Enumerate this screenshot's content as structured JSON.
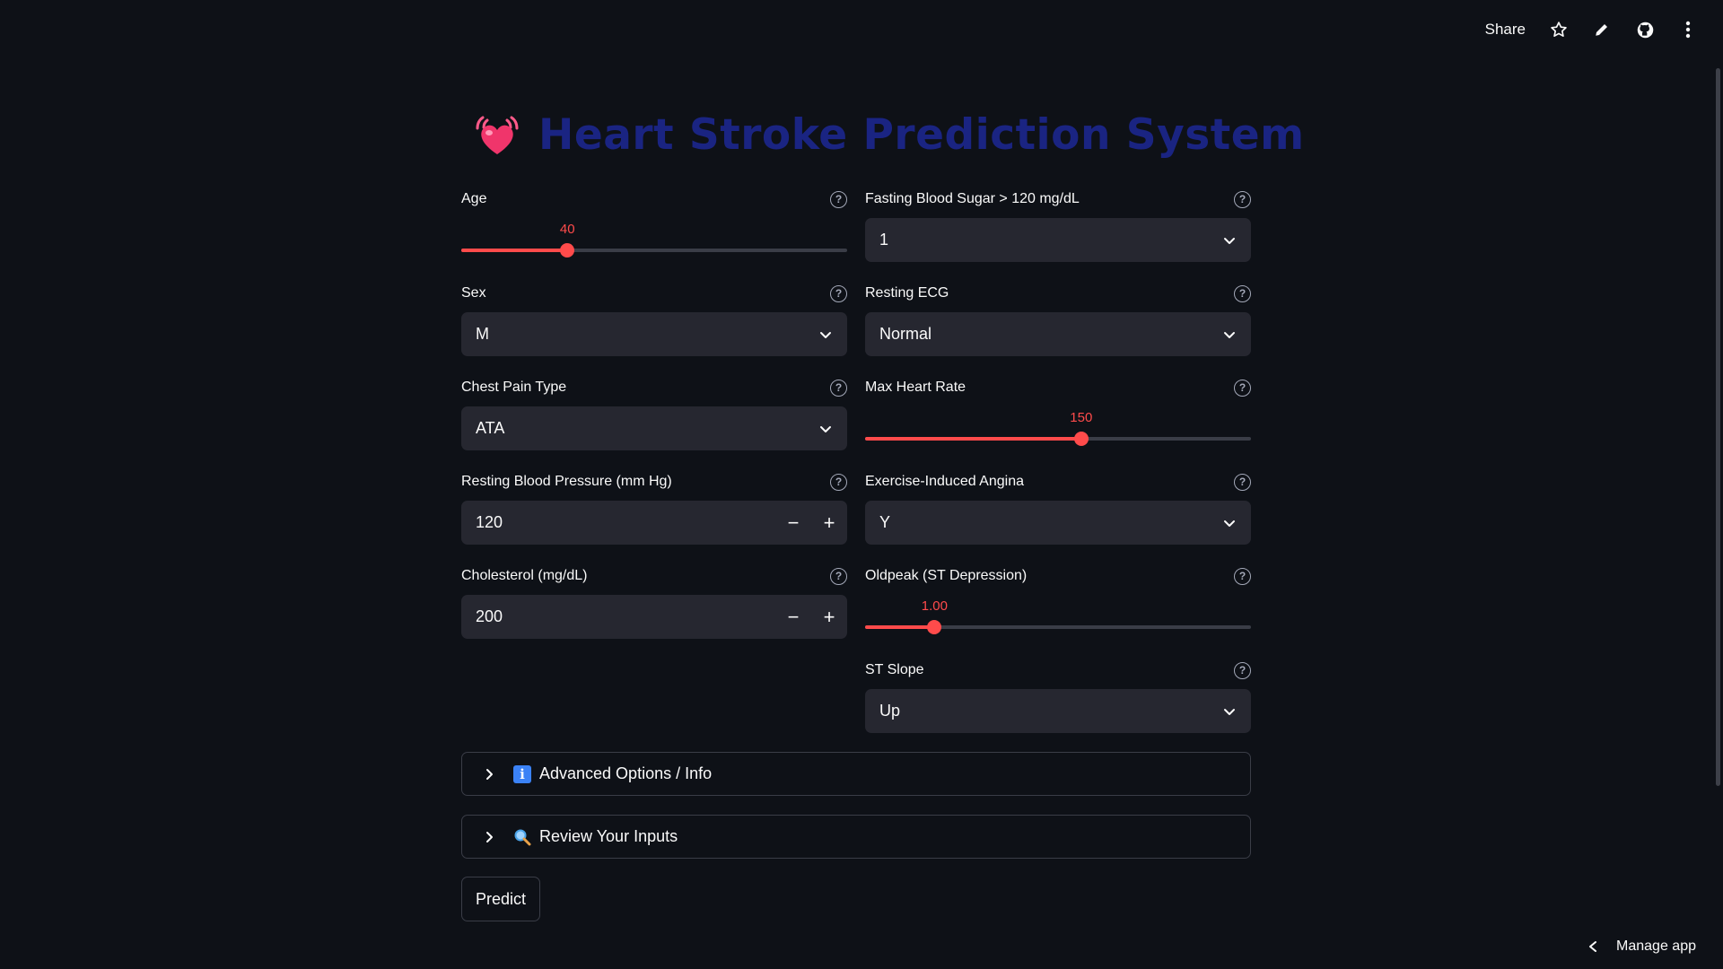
{
  "toolbar": {
    "share_label": "Share",
    "icons": [
      "star-icon",
      "pencil-icon",
      "github-icon",
      "more-vertical-icon"
    ]
  },
  "title": {
    "text": "Heart Stroke Prediction System",
    "icon": "heart-icon",
    "color": "#1a2482"
  },
  "fields": {
    "age": {
      "label": "Age",
      "value": "40",
      "min": 0,
      "max": 110,
      "fill_fraction": 0.275
    },
    "sex": {
      "label": "Sex",
      "value": "M"
    },
    "chest_pain": {
      "label": "Chest Pain Type",
      "value": "ATA"
    },
    "resting_bp": {
      "label": "Resting Blood Pressure (mm Hg)",
      "value": "120"
    },
    "cholesterol": {
      "label": "Cholesterol (mg/dL)",
      "value": "200"
    },
    "fasting_bs": {
      "label": "Fasting Blood Sugar > 120 mg/dL",
      "value": "1"
    },
    "resting_ecg": {
      "label": "Resting ECG",
      "value": "Normal"
    },
    "max_hr": {
      "label": "Max Heart Rate",
      "value": "150",
      "fill_fraction": 0.56
    },
    "exercise_angina": {
      "label": "Exercise-Induced Angina",
      "value": "Y"
    },
    "oldpeak": {
      "label": "Oldpeak (ST Depression)",
      "value": "1.00",
      "fill_fraction": 0.18
    },
    "st_slope": {
      "label": "ST Slope",
      "value": "Up"
    }
  },
  "stepper": {
    "minus": "−",
    "plus": "+"
  },
  "help_glyph": "?",
  "expanders": {
    "advanced": {
      "label": "Advanced Options / Info",
      "icon": "info-icon"
    },
    "review": {
      "label": "Review Your Inputs",
      "icon": "magnifier-icon"
    }
  },
  "predict_label": "Predict",
  "manage_label": "Manage app",
  "colors": {
    "background": "#0e1117",
    "widget_bg": "#262730",
    "accent": "#ff4b4b"
  }
}
